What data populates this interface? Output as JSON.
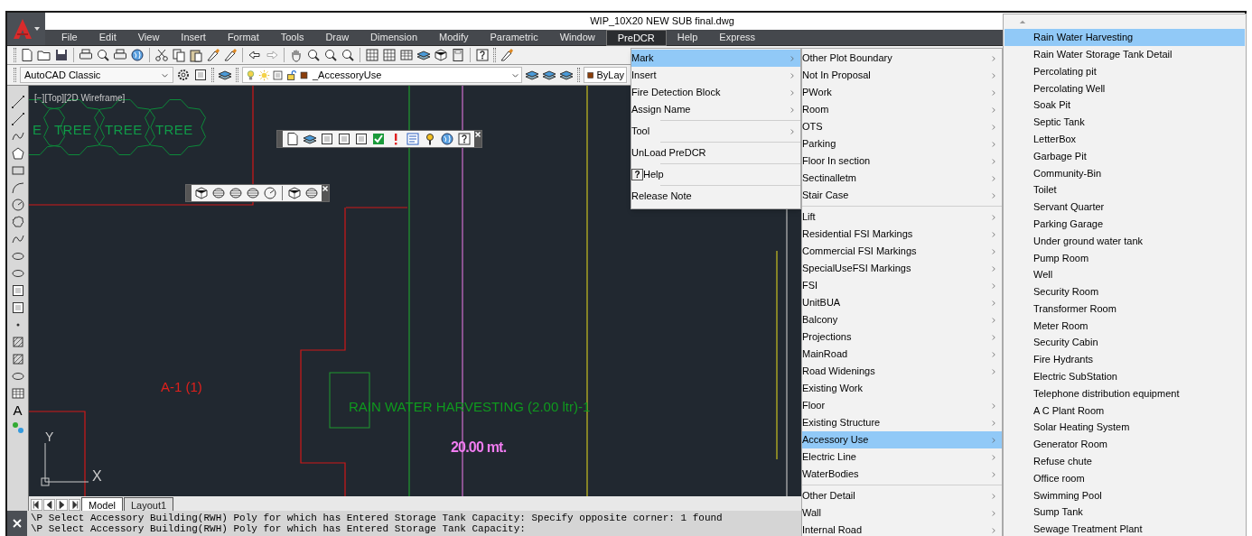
{
  "window": {
    "title": "WIP_10X20 NEW SUB final.dwg"
  },
  "menu_bar": [
    {
      "label": "File",
      "selected": false
    },
    {
      "label": "Edit",
      "selected": false
    },
    {
      "label": "View",
      "selected": false
    },
    {
      "label": "Insert",
      "selected": false
    },
    {
      "label": "Format",
      "selected": false
    },
    {
      "label": "Tools",
      "selected": false
    },
    {
      "label": "Draw",
      "selected": false
    },
    {
      "label": "Dimension",
      "selected": false
    },
    {
      "label": "Modify",
      "selected": false
    },
    {
      "label": "Parametric",
      "selected": false
    },
    {
      "label": "Window",
      "selected": false
    },
    {
      "label": "PreDCR",
      "selected": true
    },
    {
      "label": "Help",
      "selected": false
    },
    {
      "label": "Express",
      "selected": false
    }
  ],
  "toolbars": {
    "workspace": "AutoCAD Classic",
    "layer": "_AccessoryUse",
    "color_control": "ByLay"
  },
  "draw_palette": {
    "text_tool_glyph": "A"
  },
  "viewport": {
    "label": "[−][Top][2D Wireframe]",
    "tree_labels": [
      "E",
      "TREE",
      "TREE",
      "TREE"
    ],
    "texts": [
      {
        "text": "A-1 (1)",
        "color": "#e0201c"
      },
      {
        "text": "RAIN WATER HARVESTING (2.00 ltr)-1",
        "color": "#0f9a1e"
      },
      {
        "text": "20.00 mt.",
        "color": "#f07cf0"
      }
    ],
    "ucs": {
      "x_label": "X",
      "y_label": "Y"
    }
  },
  "layout_tabs": [
    {
      "label": "Model",
      "selected": true
    },
    {
      "label": "Layout1",
      "selected": false
    }
  ],
  "command_lines": [
    "\\P Select Accessory Building(RWH) Poly for which has Entered Storage Tank Capacity: Specify opposite corner: 1 found",
    "\\P Select Accessory Building(RWH) Poly for which has Entered Storage Tank Capacity:"
  ],
  "predcr_menu": [
    {
      "kind": "item",
      "label": "Mark",
      "submenu": true,
      "selected": true
    },
    {
      "kind": "item",
      "label": "Insert",
      "submenu": true,
      "selected": false
    },
    {
      "kind": "item",
      "label": "Fire Detection Block",
      "submenu": true,
      "selected": false
    },
    {
      "kind": "item",
      "label": "Assign Name",
      "submenu": true,
      "selected": false
    },
    {
      "kind": "separator"
    },
    {
      "kind": "item",
      "label": "Tool",
      "submenu": true,
      "selected": false
    },
    {
      "kind": "separator"
    },
    {
      "kind": "item",
      "label": "UnLoad PreDCR",
      "submenu": false,
      "selected": false
    },
    {
      "kind": "separator"
    },
    {
      "kind": "item",
      "label": "Help",
      "submenu": false,
      "selected": false,
      "icon_glyph": "?"
    },
    {
      "kind": "separator"
    },
    {
      "kind": "item",
      "label": "Release Note",
      "submenu": false,
      "selected": false
    }
  ],
  "mark_submenu": [
    {
      "kind": "item",
      "label": "Other Plot Boundary",
      "submenu": true,
      "selected": false
    },
    {
      "kind": "item",
      "label": "Not In Proposal",
      "submenu": true,
      "selected": false
    },
    {
      "kind": "item",
      "label": "PWork",
      "submenu": true,
      "selected": false
    },
    {
      "kind": "item",
      "label": "Room",
      "submenu": true,
      "selected": false
    },
    {
      "kind": "item",
      "label": "OTS",
      "submenu": true,
      "selected": false
    },
    {
      "kind": "item",
      "label": "Parking",
      "submenu": true,
      "selected": false
    },
    {
      "kind": "item",
      "label": "Floor In section",
      "submenu": true,
      "selected": false
    },
    {
      "kind": "item",
      "label": "Sectinalletm",
      "submenu": true,
      "selected": false
    },
    {
      "kind": "item",
      "label": "Stair Case",
      "submenu": true,
      "selected": false
    },
    {
      "kind": "separator"
    },
    {
      "kind": "item",
      "label": "Lift",
      "submenu": true,
      "selected": false
    },
    {
      "kind": "item",
      "label": "Residential FSI Markings",
      "submenu": true,
      "selected": false
    },
    {
      "kind": "item",
      "label": "Commercial FSI Markings",
      "submenu": true,
      "selected": false
    },
    {
      "kind": "item",
      "label": "SpecialUseFSI Markings",
      "submenu": true,
      "selected": false
    },
    {
      "kind": "item",
      "label": "FSI",
      "submenu": true,
      "selected": false
    },
    {
      "kind": "item",
      "label": "UnitBUA",
      "submenu": true,
      "selected": false
    },
    {
      "kind": "item",
      "label": "Balcony",
      "submenu": true,
      "selected": false
    },
    {
      "kind": "item",
      "label": "Projections",
      "submenu": true,
      "selected": false
    },
    {
      "kind": "item",
      "label": "MainRoad",
      "submenu": true,
      "selected": false
    },
    {
      "kind": "item",
      "label": "Road Widenings",
      "submenu": true,
      "selected": false
    },
    {
      "kind": "item",
      "label": "Existing Work",
      "submenu": false,
      "selected": false
    },
    {
      "kind": "item",
      "label": "Floor",
      "submenu": true,
      "selected": false
    },
    {
      "kind": "item",
      "label": "Existing Structure",
      "submenu": true,
      "selected": false
    },
    {
      "kind": "item",
      "label": "Accessory Use",
      "submenu": true,
      "selected": true
    },
    {
      "kind": "item",
      "label": "Electric Line",
      "submenu": true,
      "selected": false
    },
    {
      "kind": "item",
      "label": "WaterBodies",
      "submenu": true,
      "selected": false
    },
    {
      "kind": "separator"
    },
    {
      "kind": "item",
      "label": "Other Detail",
      "submenu": true,
      "selected": false
    },
    {
      "kind": "item",
      "label": "Wall",
      "submenu": true,
      "selected": false
    },
    {
      "kind": "item",
      "label": "Internal Road",
      "submenu": true,
      "selected": false
    }
  ],
  "accessory_submenu": [
    {
      "label": "Rain Water Harvesting",
      "selected": true
    },
    {
      "label": "Rain Water Storage Tank Detail",
      "selected": false
    },
    {
      "label": "Percolating pit",
      "selected": false
    },
    {
      "label": "Percolating Well",
      "selected": false
    },
    {
      "label": "Soak Pit",
      "selected": false
    },
    {
      "label": "Septic Tank",
      "selected": false
    },
    {
      "label": "LetterBox",
      "selected": false
    },
    {
      "label": "Garbage Pit",
      "selected": false
    },
    {
      "label": "Community-Bin",
      "selected": false
    },
    {
      "label": "Toilet",
      "selected": false
    },
    {
      "label": "Servant Quarter",
      "selected": false
    },
    {
      "label": "Parking Garage",
      "selected": false
    },
    {
      "label": "Under ground water tank",
      "selected": false
    },
    {
      "label": "Pump Room",
      "selected": false
    },
    {
      "label": "Well",
      "selected": false
    },
    {
      "label": "Security Room",
      "selected": false
    },
    {
      "label": "Transformer Room",
      "selected": false
    },
    {
      "label": "Meter Room",
      "selected": false
    },
    {
      "label": "Security Cabin",
      "selected": false
    },
    {
      "label": "Fire Hydrants",
      "selected": false
    },
    {
      "label": "Electric SubStation",
      "selected": false
    },
    {
      "label": "Telephone distribution equipment",
      "selected": false
    },
    {
      "label": "A C Plant Room",
      "selected": false
    },
    {
      "label": "Solar Heating System",
      "selected": false
    },
    {
      "label": "Generator Room",
      "selected": false
    },
    {
      "label": "Refuse chute",
      "selected": false
    },
    {
      "label": "Office room",
      "selected": false
    },
    {
      "label": "Swimming Pool",
      "selected": false
    },
    {
      "label": "Sump Tank",
      "selected": false
    },
    {
      "label": "Sewage Treatment Plant",
      "selected": false
    }
  ]
}
